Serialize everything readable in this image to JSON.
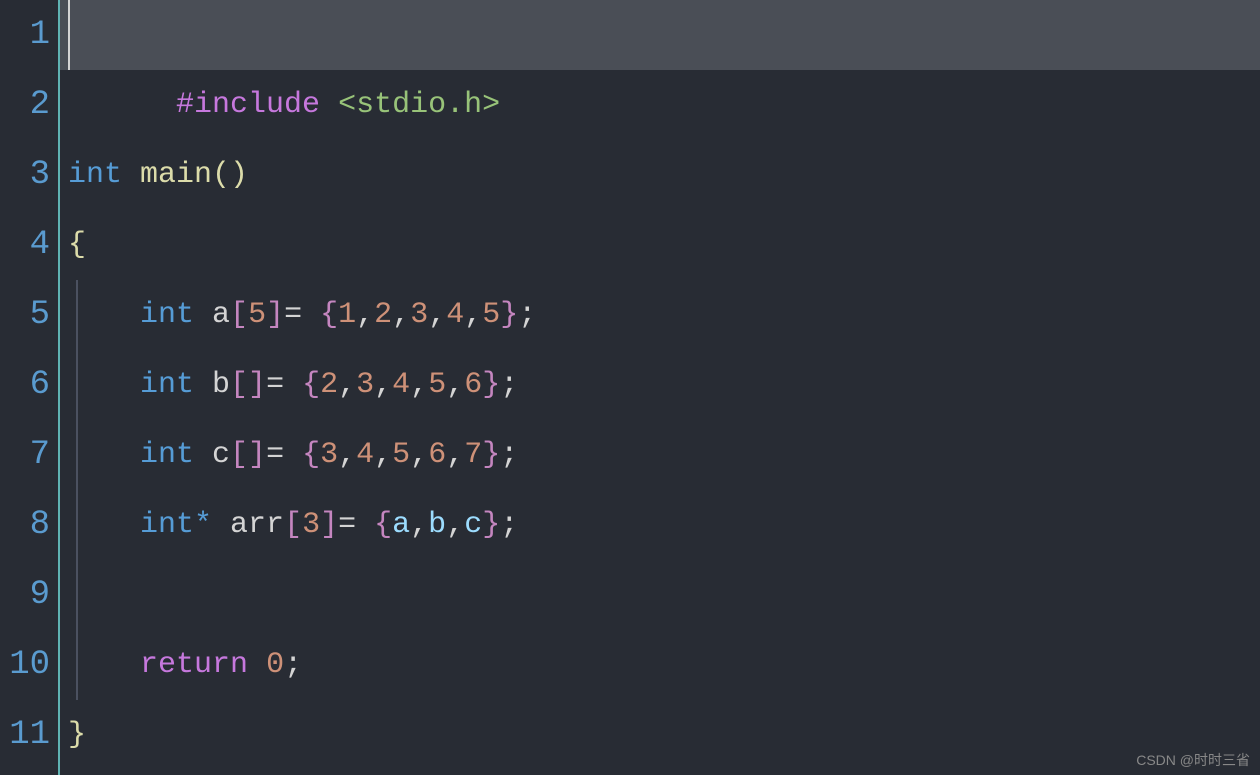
{
  "line_numbers": [
    "1",
    "2",
    "3",
    "4",
    "5",
    "6",
    "7",
    "8",
    "9",
    "10",
    "11"
  ],
  "code": {
    "l1_include": "#include",
    "l1_space": " ",
    "l1_angle_open": "<",
    "l1_header": "stdio.h",
    "l1_angle_close": ">",
    "l3_int": "int",
    "l3_main": "main",
    "l3_parens": "()",
    "l4_brace": "{",
    "l5_indent": "    ",
    "l5_int": "int",
    "l5_var": " a",
    "l5_bracket_open": "[",
    "l5_size": "5",
    "l5_bracket_close": "]",
    "l5_eq": "= ",
    "l5_brace_open": "{",
    "l5_v1": "1",
    "l5_v2": "2",
    "l5_v3": "3",
    "l5_v4": "4",
    "l5_v5": "5",
    "l5_brace_close": "}",
    "l5_semi": ";",
    "l6_int": "int",
    "l6_var": " b",
    "l6_brackets": "[]",
    "l6_eq": "= ",
    "l6_brace_open": "{",
    "l6_v1": "2",
    "l6_v2": "3",
    "l6_v3": "4",
    "l6_v4": "5",
    "l6_v5": "6",
    "l6_brace_close": "}",
    "l6_semi": ";",
    "l7_int": "int",
    "l7_var": " c",
    "l7_brackets": "[]",
    "l7_eq": "= ",
    "l7_brace_open": "{",
    "l7_v1": "3",
    "l7_v2": "4",
    "l7_v3": "5",
    "l7_v4": "6",
    "l7_v5": "7",
    "l7_brace_close": "}",
    "l7_semi": ";",
    "l8_int": "int",
    "l8_star": "*",
    "l8_var": " arr",
    "l8_bracket_open": "[",
    "l8_size": "3",
    "l8_bracket_close": "]",
    "l8_eq": "= ",
    "l8_brace_open": "{",
    "l8_a": "a",
    "l8_b": "b",
    "l8_c": "c",
    "l8_brace_close": "}",
    "l8_semi": ";",
    "l10_return": "return",
    "l10_zero": "0",
    "l10_semi": ";",
    "l11_brace": "}",
    "comma": ","
  },
  "watermark": "CSDN @时时三省"
}
